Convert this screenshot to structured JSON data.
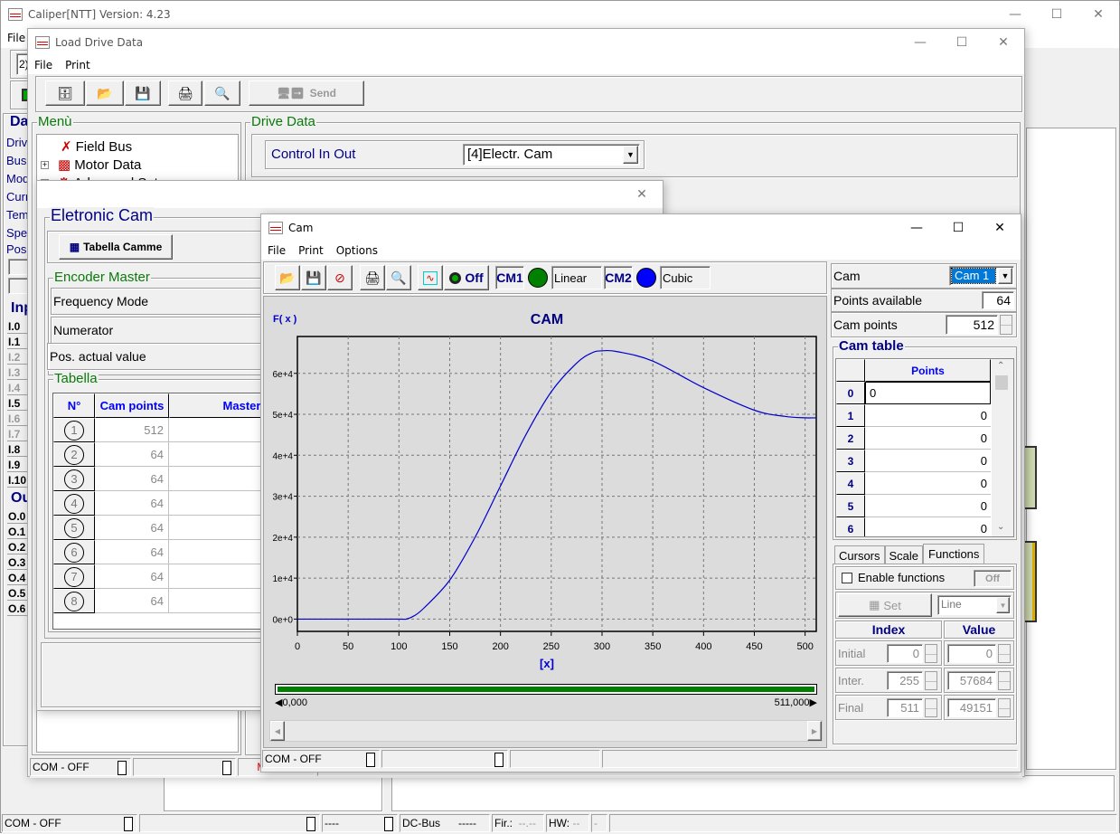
{
  "main_window": {
    "title": "Caliper[NTT] Version: 4.23",
    "menu": [
      "File"
    ],
    "combo_value": "2)",
    "left_panel": {
      "header": "Da",
      "items": [
        "Drive",
        "Bus",
        "Mode",
        "Curre",
        "Temp",
        "Spee"
      ],
      "pos_label": "Pos",
      "inputs_header": "Inp",
      "inputs": [
        {
          "label": "I.0",
          "active": true
        },
        {
          "label": "I.1",
          "active": true
        },
        {
          "label": "I.2",
          "active": false
        },
        {
          "label": "I.3",
          "active": false
        },
        {
          "label": "I.4",
          "active": false
        },
        {
          "label": "I.5",
          "active": true
        },
        {
          "label": "I.6",
          "active": false
        },
        {
          "label": "I.7",
          "active": false
        },
        {
          "label": "I.8",
          "active": true
        },
        {
          "label": "I.9",
          "active": true
        },
        {
          "label": "I.10",
          "active": true
        }
      ],
      "outputs_header": "Ou",
      "outputs": [
        "O.0",
        "O.1",
        "O.2",
        "O.3",
        "O.4",
        "O.5",
        "O.6"
      ]
    },
    "status": {
      "com": "COM - OFF",
      "cell3": "----",
      "dcbus_label": "DC-Bus",
      "dcbus_value": "-----",
      "fir_label": "Fir.:",
      "fir_value": "--.--",
      "hw_label": "HW:",
      "hw_value": "--",
      "last": "-"
    }
  },
  "load_drive_window": {
    "title": "Load Drive Data",
    "menu": [
      "File",
      "Print"
    ],
    "toolbar": {
      "send_label": "Send"
    },
    "menu_group": {
      "label": "Menù",
      "tree": [
        {
          "label": "Field Bus",
          "expandable": false
        },
        {
          "label": "Motor Data",
          "expandable": true
        },
        {
          "label": "Advanced Setup",
          "expandable": true
        }
      ]
    },
    "drive_data": {
      "label": "Drive Data",
      "field_label": "Control In Out",
      "field_value": "[4]Electr. Cam"
    },
    "status": {
      "com": "COM - OFF",
      "modified": "Modified"
    }
  },
  "electronic_cam_dialog": {
    "group_label": "Eletronic Cam",
    "tabella_button": "Tabella Camme",
    "encoder_master_label": "Encoder Master",
    "frequency_mode": "Frequency Mode",
    "numerator": "Numerator",
    "pos_actual": "Pos. actual value",
    "tabella_label": "Tabella",
    "table": {
      "headers": [
        "N°",
        "Cam points",
        "Master modu"
      ],
      "rows": [
        {
          "n": "1",
          "cam_points": "512"
        },
        {
          "n": "2",
          "cam_points": "64"
        },
        {
          "n": "3",
          "cam_points": "64"
        },
        {
          "n": "4",
          "cam_points": "64"
        },
        {
          "n": "5",
          "cam_points": "64"
        },
        {
          "n": "6",
          "cam_points": "64"
        },
        {
          "n": "7",
          "cam_points": "64"
        },
        {
          "n": "8",
          "cam_points": "64"
        }
      ]
    }
  },
  "cam_window": {
    "title": "Cam",
    "menu": [
      "File",
      "Print",
      "Options"
    ],
    "toolbar": {
      "off_label": "Off",
      "cm1_label": "CM1",
      "cm1_mode": "Linear",
      "cm1_color": "#008000",
      "cm2_label": "CM2",
      "cm2_mode": "Cubic",
      "cm2_color": "#0000ff"
    },
    "range": {
      "start": "0,000",
      "end": "511,000"
    },
    "side": {
      "cam_label": "Cam",
      "cam_value": "Cam 1",
      "points_available_label": "Points available",
      "points_available": "64",
      "cam_points_label": "Cam points",
      "cam_points": "512",
      "cam_table_label": "Cam table",
      "cam_table_header": "Points",
      "cam_table_rows": [
        {
          "index": "0",
          "value": "0"
        },
        {
          "index": "1",
          "value": "0"
        },
        {
          "index": "2",
          "value": "0"
        },
        {
          "index": "3",
          "value": "0"
        },
        {
          "index": "4",
          "value": "0"
        },
        {
          "index": "5",
          "value": "0"
        },
        {
          "index": "6",
          "value": "0"
        }
      ],
      "tabs": [
        "Cursors",
        "Scale",
        "Functions"
      ],
      "active_tab": "Functions",
      "enable_functions_label": "Enable functions",
      "enable_functions_checked": false,
      "off_button": "Off",
      "set_button": "Set",
      "function_type": "Line",
      "index_header": "Index",
      "value_header": "Value",
      "rows": [
        {
          "label": "Initial",
          "index": "0",
          "value": "0"
        },
        {
          "label": "Inter.",
          "index": "255",
          "value": "57684"
        },
        {
          "label": "Final",
          "index": "511",
          "value": "49151"
        }
      ]
    },
    "status": {
      "com": "COM - OFF"
    }
  },
  "chart_data": {
    "type": "line",
    "title": "CAM",
    "xlabel": "[x]",
    "ylabel": "F( x )",
    "xlim": [
      0,
      511
    ],
    "ylim": [
      -3000,
      69000
    ],
    "xticks": [
      0,
      50,
      100,
      150,
      200,
      250,
      300,
      350,
      400,
      450,
      500
    ],
    "yticks": [
      0,
      10000,
      20000,
      30000,
      40000,
      50000,
      60000
    ],
    "ytick_labels": [
      "0e+0",
      "1e+4",
      "2e+4",
      "3e+4",
      "4e+4",
      "5e+4",
      "6e+4"
    ],
    "grid": true,
    "series": [
      {
        "name": "Cam 1",
        "color": "#0000cc",
        "x": [
          0,
          50,
          100,
          107,
          115,
          125,
          150,
          175,
          200,
          225,
          250,
          275,
          290,
          300,
          315,
          350,
          400,
          450,
          480,
          500,
          511
        ],
        "y": [
          0,
          0,
          0,
          0,
          800,
          2800,
          9500,
          20000,
          32500,
          45000,
          55500,
          62500,
          65000,
          65500,
          65300,
          63000,
          56500,
          51000,
          49500,
          49151,
          49151
        ]
      }
    ]
  }
}
